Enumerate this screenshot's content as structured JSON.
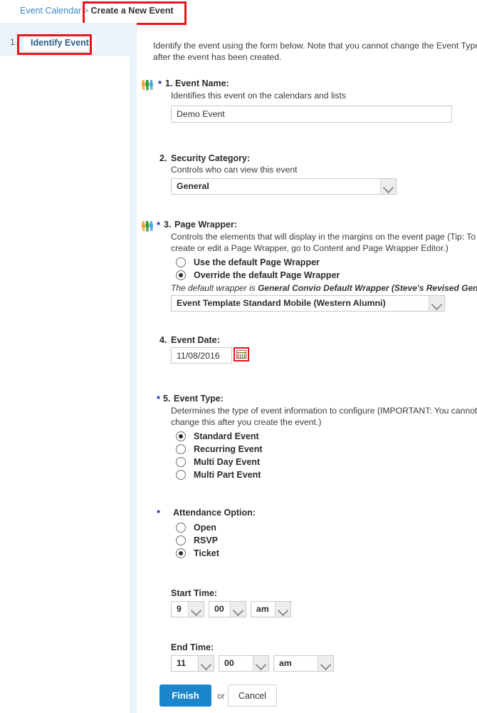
{
  "breadcrumb": {
    "parent": "Event Calendar",
    "separator": ">",
    "current": "Create a New Event"
  },
  "wizard": {
    "steps": [
      {
        "number": "1.",
        "label": "Identify Event"
      }
    ]
  },
  "panel": {
    "intro": "Identify the event using the form below. Note that you cannot change the Event Type after the event has been created.",
    "required_marker": "*"
  },
  "fields": {
    "event_name": {
      "number": "1.",
      "label": "Event Name:",
      "help": "Identifies this event on the calendars and lists",
      "value": "Demo Event",
      "placeholder": "",
      "icon": "people-icon"
    },
    "security_category": {
      "number": "2.",
      "label": "Security Category:",
      "help": "Controls who can view this event",
      "value": "General",
      "options": [
        "General"
      ]
    },
    "page_wrapper": {
      "number": "3.",
      "label": "Page Wrapper:",
      "help": "Controls the elements that will display in the margins on the event page (Tip: To create or edit a Page Wrapper, go to Content and Page Wrapper Editor.)",
      "icon": "people-icon",
      "radios": [
        {
          "label": "Use the default Page Wrapper",
          "selected": false
        },
        {
          "label": "Override the default Page Wrapper",
          "selected": true
        }
      ],
      "default_note_prefix": "The default wrapper is ",
      "default_note_value": "General Convio Default Wrapper (Steve's Revised General Wrapper)",
      "value": "Event Template Standard Mobile (Western Alumni)",
      "options": [
        "Event Template Standard Mobile (Western Alumni)"
      ]
    },
    "event_date": {
      "number": "4.",
      "label": "Event Date:",
      "value": "11/08/2016",
      "calendar_icon": "calendar-icon"
    },
    "event_type": {
      "number": "5.",
      "label": "Event Type:",
      "help": "Determines the type of event information to configure (IMPORTANT: You cannot change this after you create the event.)",
      "radios": [
        {
          "label": "Standard Event",
          "selected": true
        },
        {
          "label": "Recurring Event",
          "selected": false
        },
        {
          "label": "Multi Day Event",
          "selected": false
        },
        {
          "label": "Multi Part Event",
          "selected": false
        }
      ]
    },
    "attendance_option": {
      "label": "Attendance Option:",
      "radios": [
        {
          "label": "Open",
          "selected": false
        },
        {
          "label": "RSVP",
          "selected": false
        },
        {
          "label": "Ticket",
          "selected": true
        }
      ]
    },
    "start_time": {
      "label": "Start Time:",
      "hour": "9",
      "minute": "00",
      "meridiem": "am"
    },
    "end_time": {
      "label": "End Time:",
      "hour": "11",
      "minute": "00",
      "meridiem": "am"
    }
  },
  "actions": {
    "finish_label": "Finish",
    "or_label": "or",
    "cancel_label": "Cancel"
  },
  "colors": {
    "accent_blue": "#1b86cb",
    "link_blue": "#3a8cc8",
    "rail_blue": "#eaf3fb",
    "annotation_red": "#e8151c",
    "required_star": "#2026c8"
  }
}
